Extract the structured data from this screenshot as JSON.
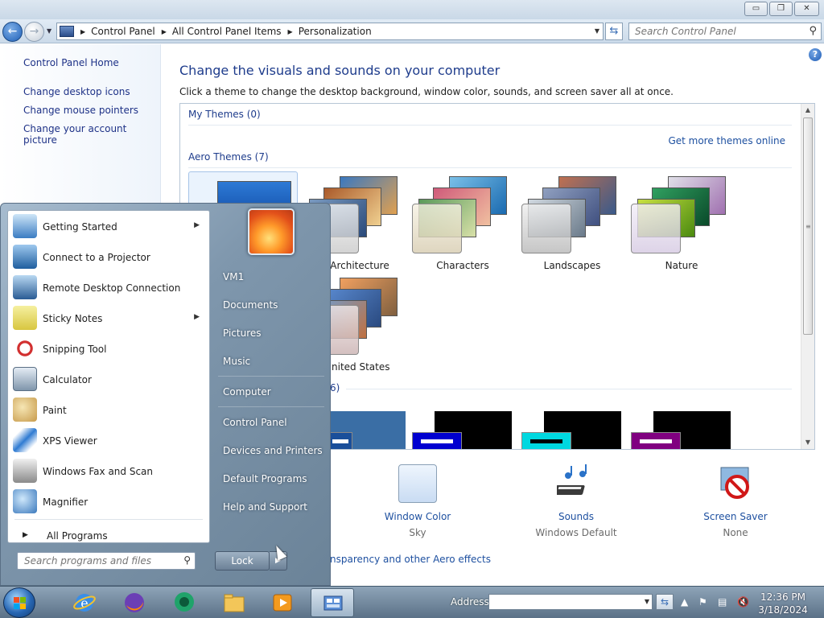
{
  "window": {
    "caption_buttons": {
      "minimize": "▭",
      "maximize": "❐",
      "close": "✕"
    }
  },
  "nav": {
    "back_icon": "back-arrow-icon",
    "forward_icon": "forward-arrow-icon",
    "breadcrumbs": [
      "Control Panel",
      "All Control Panel Items",
      "Personalization"
    ],
    "search_placeholder": "Search Control Panel"
  },
  "left_pane": {
    "home": "Control Panel Home",
    "links": [
      "Change desktop icons",
      "Change mouse pointers",
      "Change your account picture"
    ]
  },
  "main": {
    "title": "Change the visuals and sounds on your computer",
    "subtitle": "Click a theme to change the desktop background, window color, sounds, and screen saver all at once.",
    "my_themes": "My Themes (0)",
    "get_more": "Get more themes online",
    "aero_themes": "Aero Themes (7)",
    "themes": [
      "Architecture",
      "Characters",
      "Landscapes",
      "Nature",
      "nited States"
    ],
    "basic_count": "6)",
    "customize": {
      "window_color": {
        "title": "Window Color",
        "value": "Sky"
      },
      "sounds": {
        "title": "Sounds",
        "value": "Windows Default"
      },
      "screen_saver": {
        "title": "Screen Saver",
        "value": "None"
      }
    },
    "aero_link": "nsparency and other Aero effects"
  },
  "start_menu": {
    "programs": [
      {
        "label": "Getting Started",
        "submenu": true
      },
      {
        "label": "Connect to a Projector",
        "submenu": false
      },
      {
        "label": "Remote Desktop Connection",
        "submenu": false
      },
      {
        "label": "Sticky Notes",
        "submenu": true
      },
      {
        "label": "Snipping Tool",
        "submenu": false
      },
      {
        "label": "Calculator",
        "submenu": false
      },
      {
        "label": "Paint",
        "submenu": false
      },
      {
        "label": "XPS Viewer",
        "submenu": false
      },
      {
        "label": "Windows Fax and Scan",
        "submenu": false
      },
      {
        "label": "Magnifier",
        "submenu": false
      }
    ],
    "all_programs": "All Programs",
    "search_placeholder": "Search programs and files",
    "right_items": [
      "VM1",
      "Documents",
      "Pictures",
      "Music",
      "Computer",
      "Control Panel",
      "Devices and Printers",
      "Default Programs",
      "Help and Support"
    ],
    "lock": "Lock"
  },
  "taskbar": {
    "address_label": "Address",
    "time": "12:36 PM",
    "date": "3/18/2024"
  }
}
